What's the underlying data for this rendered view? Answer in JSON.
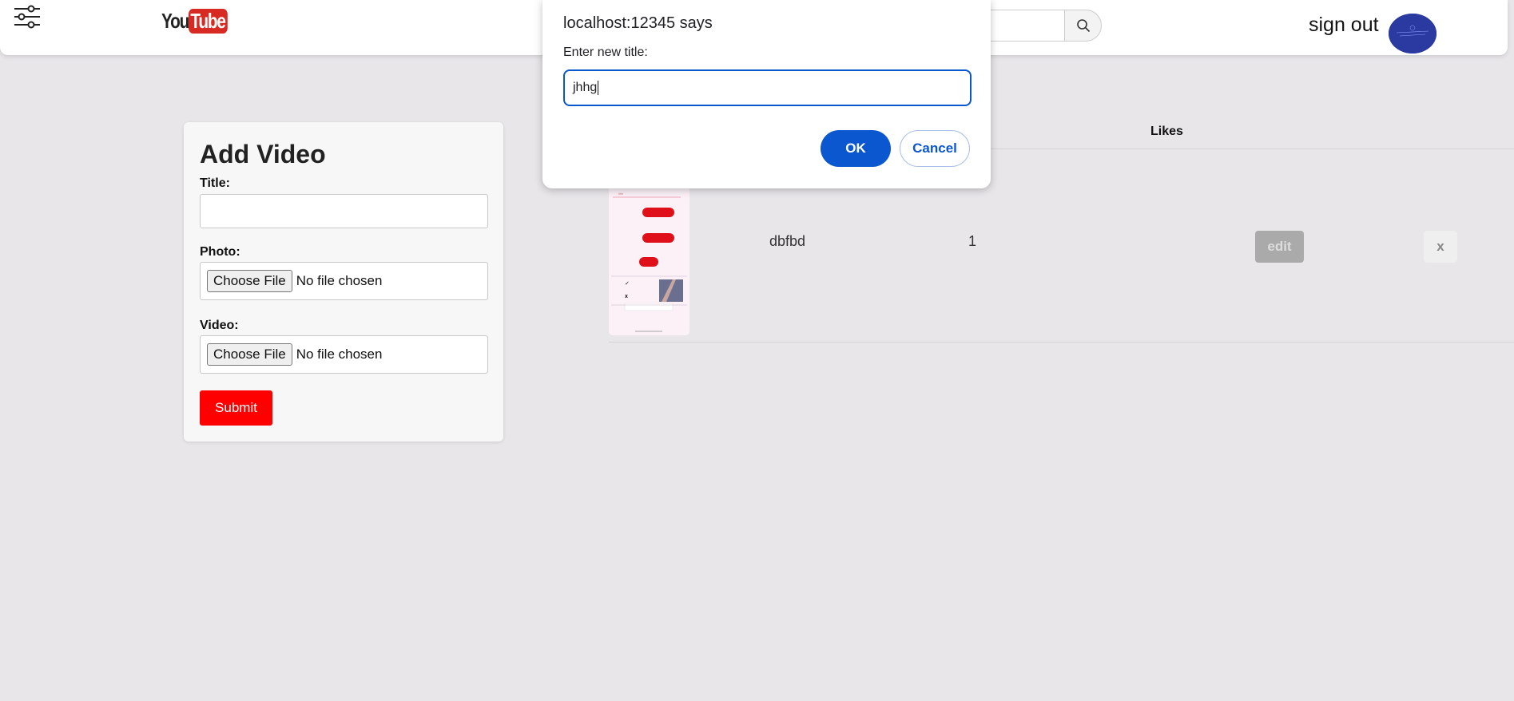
{
  "header": {
    "logo_you": "You",
    "logo_tube": "Tube",
    "signout_label": "sign out"
  },
  "form": {
    "heading": "Add Video",
    "title_label": "Title:",
    "title_value": "",
    "photo_label": "Photo:",
    "video_label": "Video:",
    "choose_file_label": "Choose File",
    "no_file_label": "No file chosen",
    "submit_label": "Submit"
  },
  "table": {
    "likes_header": "Likes",
    "rows": [
      {
        "title": "dbfbd",
        "likes": "1",
        "edit_label": "edit",
        "delete_label": "x"
      }
    ]
  },
  "dialog": {
    "title": "localhost:12345 says",
    "message": "Enter new title:",
    "input_value": "jhhg",
    "ok_label": "OK",
    "cancel_label": "Cancel"
  },
  "colors": {
    "accent_red": "#ff0000",
    "dialog_blue": "#0b57d0",
    "page_bg": "#e8e6e9"
  },
  "icons": {
    "menu": "sliders-icon",
    "search": "search-icon"
  }
}
